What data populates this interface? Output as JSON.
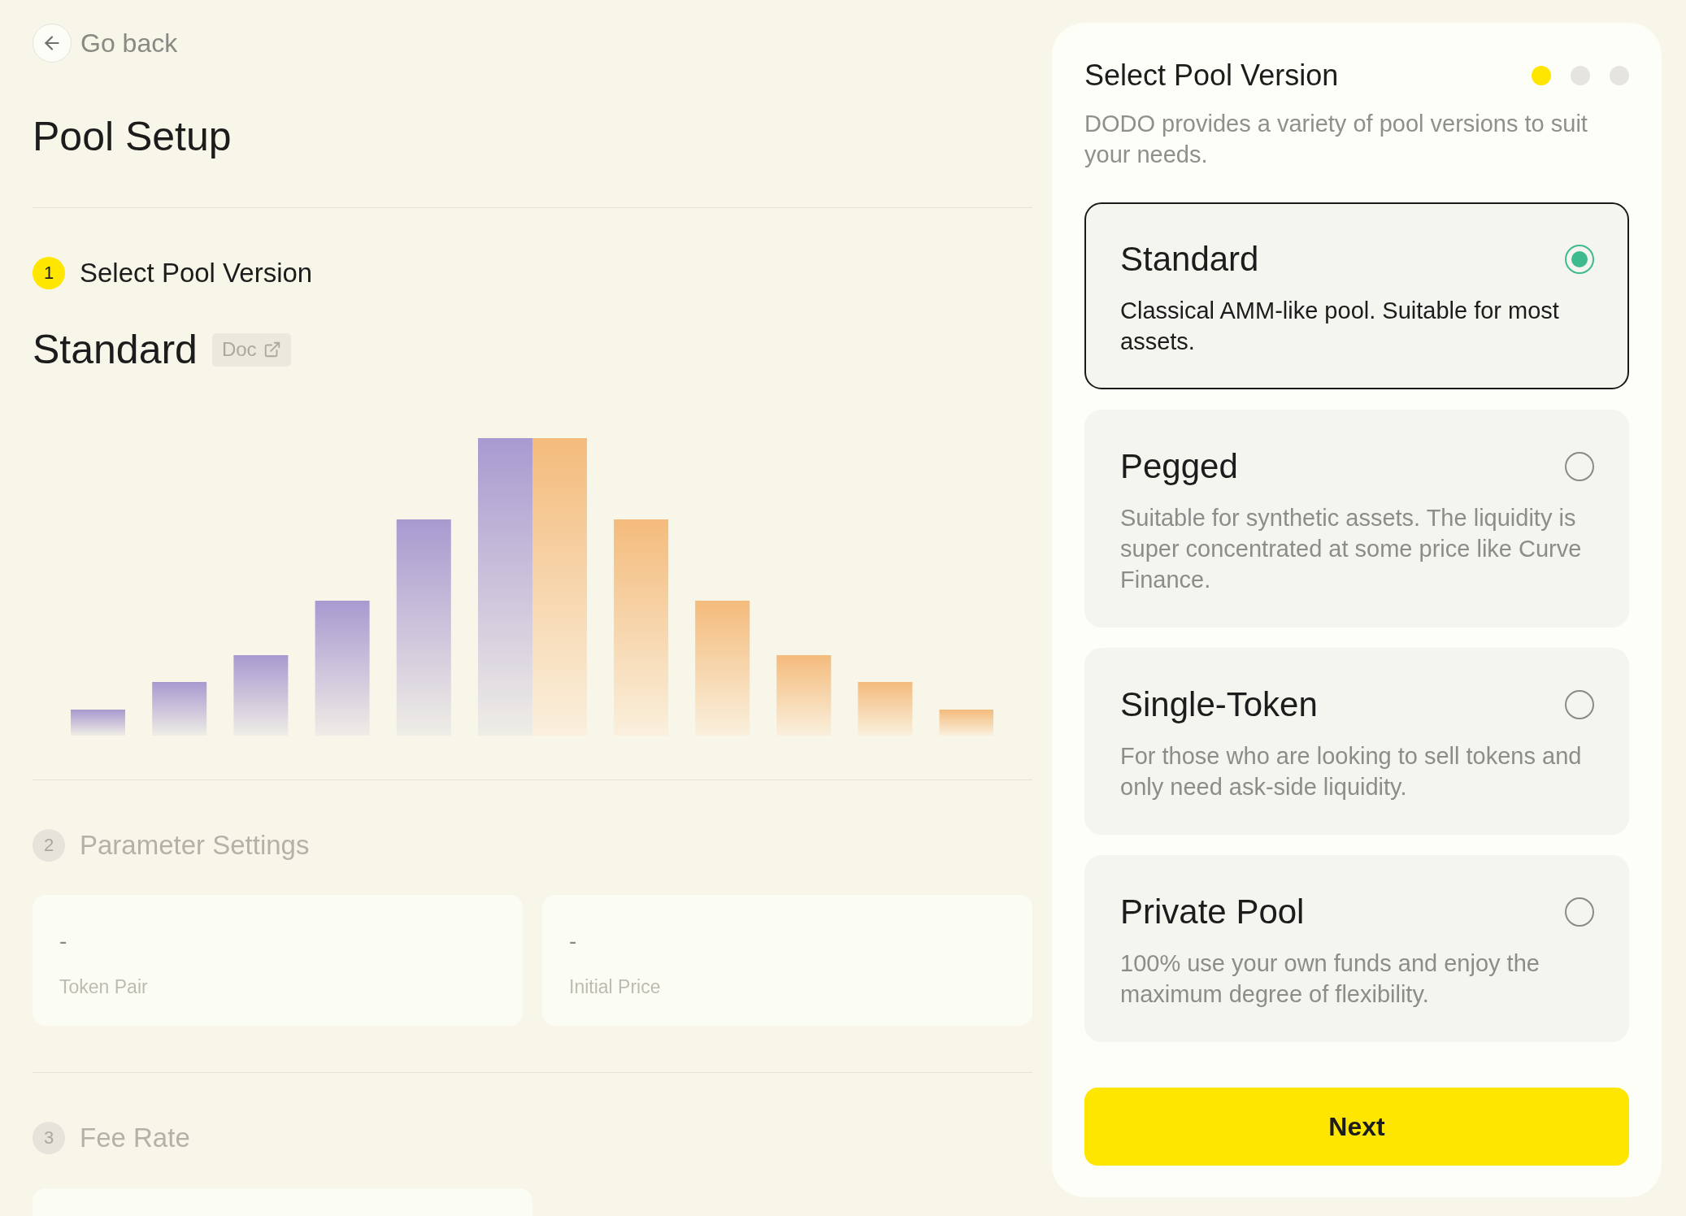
{
  "back_link": {
    "label": "Go back"
  },
  "page_title": "Pool Setup",
  "steps": [
    {
      "number": "1",
      "title": "Select Pool Version",
      "active": true,
      "kind": "version",
      "version_name": "Standard",
      "doc_label": "Doc"
    },
    {
      "number": "2",
      "title": "Parameter Settings",
      "active": false,
      "kind": "fields",
      "fields": [
        {
          "value": "-",
          "label": "Token Pair"
        },
        {
          "value": "-",
          "label": "Initial Price"
        }
      ]
    },
    {
      "number": "3",
      "title": "Fee Rate",
      "active": false,
      "kind": "card"
    }
  ],
  "version_panel": {
    "title": "Select Pool Version",
    "pager": [
      {
        "selected": true
      },
      {
        "selected": false
      },
      {
        "selected": false
      }
    ],
    "description": "DODO provides a variety of pool versions to suit your needs.",
    "options": [
      {
        "name": "Standard",
        "description": "Classical AMM-like pool. Suitable for most assets.",
        "selected": true
      },
      {
        "name": "Pegged",
        "description": "Suitable for synthetic assets. The liquidity is super concentrated at some price like Curve Finance.",
        "selected": false
      },
      {
        "name": "Single-Token",
        "description": "For those who are looking to sell tokens and only need ask-side liquidity.",
        "selected": false
      },
      {
        "name": "Private Pool",
        "description": "100% use your own funds and enjoy the maximum degree of flexibility.",
        "selected": false
      }
    ],
    "next_button": "Next"
  }
}
